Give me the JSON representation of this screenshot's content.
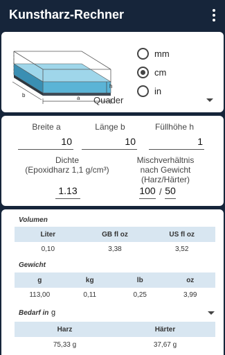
{
  "app": {
    "title": "Kunstharz-Rechner"
  },
  "shape": {
    "diagram_labels": {
      "a": "a",
      "b": "b",
      "h": "h"
    },
    "units": [
      {
        "label": "mm",
        "checked": false
      },
      {
        "label": "cm",
        "checked": true
      },
      {
        "label": "in",
        "checked": false
      }
    ],
    "selected_shape": "Quader"
  },
  "inputs": {
    "breite_label": "Breite a",
    "breite_value": "10",
    "laenge_label": "Länge b",
    "laenge_value": "10",
    "fuellhoehe_label": "Füllhöhe h",
    "fuellhoehe_value": "1",
    "dichte_label_1": "Dichte",
    "dichte_label_2": "(Epoxidharz 1,1 g/cm³)",
    "dichte_value": "1.13",
    "mix_label_1": "Mischverhältnis",
    "mix_label_2": "nach Gewicht",
    "mix_label_3": "(Harz/Härter)",
    "mix_harz": "100",
    "mix_separator": "/",
    "mix_haerter": "50"
  },
  "results": {
    "volumen": {
      "title": "Volumen",
      "headers": [
        "Liter",
        "GB fl oz",
        "US fl oz"
      ],
      "values": [
        "0,10",
        "3,38",
        "3,52"
      ]
    },
    "gewicht": {
      "title": "Gewicht",
      "headers": [
        "g",
        "kg",
        "lb",
        "oz"
      ],
      "values": [
        "113,00",
        "0,11",
        "0,25",
        "3,99"
      ]
    },
    "bedarf": {
      "title": "Bedarf in",
      "unit": "g",
      "headers": [
        "Harz",
        "Härter"
      ],
      "values": [
        "75,33 g",
        "37,67 g"
      ]
    }
  },
  "colors": {
    "appbar": "#16253a",
    "card": "#ffffff",
    "table_header": "#d8e6f1",
    "box_top": "#9fd6ea",
    "box_front": "#5bb4d6",
    "box_side": "#3a8fb3",
    "box_bottom": "#3f4a55"
  }
}
